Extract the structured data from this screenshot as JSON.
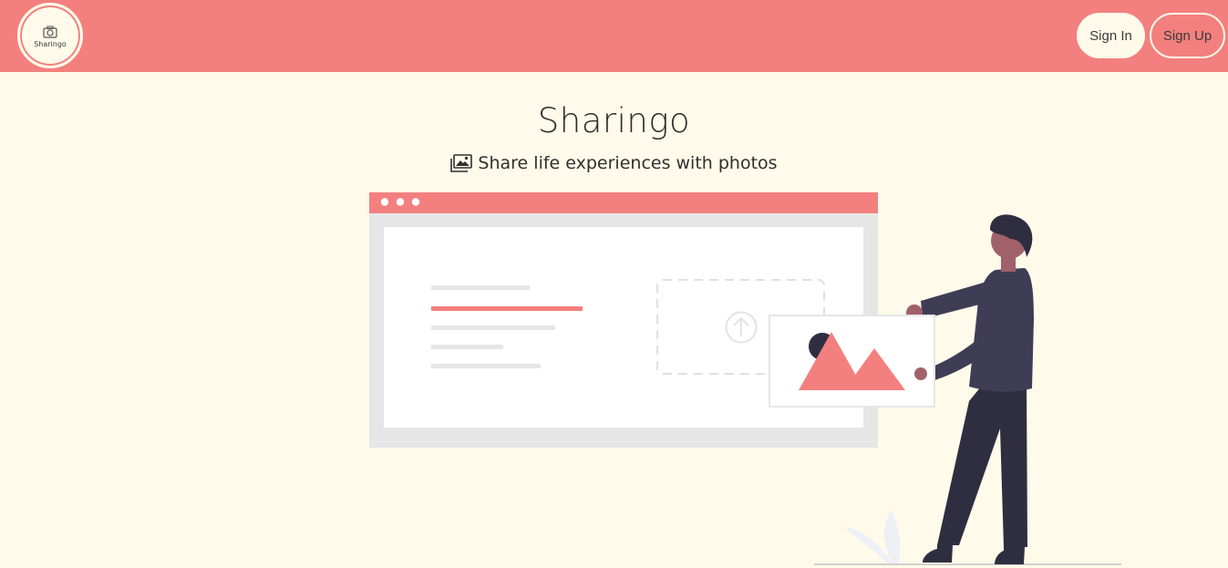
{
  "navbar": {
    "logo_text": "Sharingo",
    "sign_in_label": "Sign In",
    "sign_up_label": "Sign Up",
    "logo_icon": "camera-icon"
  },
  "hero": {
    "title": "Sharingo",
    "subtitle": "Share life experiences with photos",
    "subtitle_icon": "photo-gallery-icon"
  },
  "colors": {
    "accent": "#f3807e",
    "background": "#fffae9",
    "figure_dark": "#2f2e41",
    "figure_shirt": "#3f3d56"
  }
}
